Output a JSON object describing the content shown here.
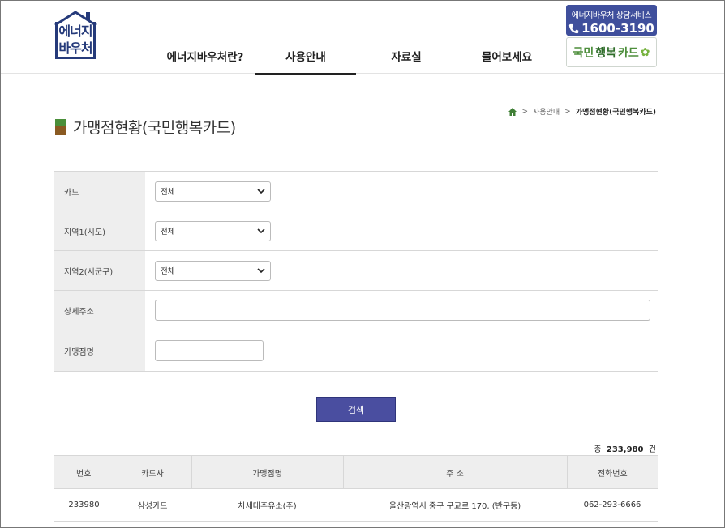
{
  "logo": {
    "line1": "에너지",
    "line2": "바우처"
  },
  "nav": {
    "items": [
      {
        "label": "에너지바우처란?"
      },
      {
        "label": "사용안내"
      },
      {
        "label": "자료실"
      },
      {
        "label": "물어보세요"
      }
    ]
  },
  "hotline": {
    "label": "에너지바우처 상담서비스",
    "number": "1600-3190"
  },
  "card_logo": {
    "prefix": "국민",
    "emph": "행복",
    "suffix": "카드"
  },
  "breadcrumb": {
    "parent": "사용안내",
    "current": "가맹점현황(국민행복카드)"
  },
  "page": {
    "title": "가맹점현황(국민행복카드)"
  },
  "form": {
    "card": {
      "label": "카드",
      "value": "전체"
    },
    "region1": {
      "label": "지역1(시도)",
      "value": "전체"
    },
    "region2": {
      "label": "지역2(시군구)",
      "value": "전체"
    },
    "address": {
      "label": "상세주소",
      "value": ""
    },
    "store": {
      "label": "가맹점명",
      "value": ""
    }
  },
  "search_label": "검색",
  "total": {
    "prefix": "총",
    "count": "233,980",
    "unit": "건"
  },
  "table": {
    "headers": [
      "번호",
      "카드사",
      "가맹점명",
      "주 소",
      "전화번호"
    ],
    "rows": [
      [
        "233980",
        "삼성카드",
        "차세대주유소(주)",
        "울산광역시 중구 구교로 170, (반구동)",
        "062-293-6666"
      ]
    ]
  },
  "colors": {
    "brand_navy": "#253a7a",
    "button": "#4a4ea0",
    "hotline_bg": "#3f4f9c",
    "green": "#4a8f3a"
  }
}
